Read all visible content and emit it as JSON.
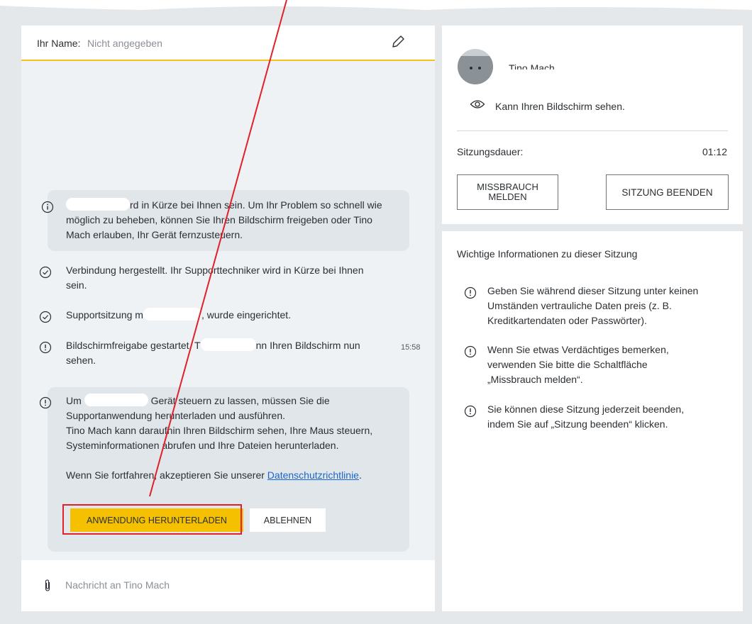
{
  "chat": {
    "name_label": "Ihr Name:",
    "name_value": "Nicht angegeben",
    "messages": [
      {
        "lines": [
          "rd in Kürze bei Ihnen sein. Um Ihr Problem so schnell wie",
          "möglich zu beheben, können Sie Ihren Bildschirm freigeben oder Tino",
          "Mach erlauben, Ihr Gerät fernzusteuern."
        ]
      },
      {
        "lines": [
          "Verbindung hergestellt. Ihr Supporttechniker wird in Kürze bei Ihnen",
          "sein."
        ]
      },
      {
        "part1": "Supportsitzung m",
        "part2": ", wurde eingerichtet."
      },
      {
        "part1": "Bildschirmfreigabe gestartet. T",
        "part2": "nn Ihren Bildschirm nun",
        "line2": "sehen.",
        "time": "15:58"
      },
      {
        "part1": "Um",
        "part2": "Gerät steuern zu lassen, müssen Sie die",
        "lines": [
          "Supportanwendung herunterladen und ausführen.",
          "Tino Mach kann daraufhin Ihren Bildschirm sehen, Ihre Maus steuern,",
          "Systeminformationen abrufen und Ihre Dateien herunterladen."
        ],
        "consent_text": "Wenn Sie fortfahren, akzeptieren Sie unserer",
        "privacy_link": "Datenschutzrichtlinie",
        "period": ".",
        "download_button": "ANWENDUNG HERUNTERLADEN",
        "decline_button": "ABLEHNEN"
      }
    ],
    "input_placeholder": "Nachricht an Tino Mach"
  },
  "session": {
    "technician_name": "Tino Mach",
    "view_status": "Kann Ihren Bildschirm sehen.",
    "duration_label": "Sitzungsdauer:",
    "duration_value": "01:12",
    "report_button_line1": "MISSBRAUCH",
    "report_button_line2": "MELDEN",
    "end_button": "SITZUNG BEENDEN"
  },
  "info": {
    "title": "Wichtige Informationen zu dieser Sitzung",
    "items": [
      {
        "lines": [
          "Geben Sie während dieser Sitzung unter keinen",
          "Umständen vertrauliche Daten preis (z. B.",
          "Kreditkartendaten oder Passwörter)."
        ]
      },
      {
        "lines": [
          "Wenn Sie etwas Verdächtiges bemerken,",
          "verwenden Sie bitte die Schaltfläche",
          "„Missbrauch melden“."
        ]
      },
      {
        "lines": [
          "Sie können diese Sitzung jederzeit beenden,",
          "indem Sie auf „Sitzung beenden“ klicken."
        ]
      }
    ]
  },
  "colors": {
    "accent": "#f5c000",
    "highlight": "#e0202a",
    "link": "#1a66c9",
    "panel_bg": "#eef2f5"
  },
  "icons": [
    "pencil-icon",
    "info-icon",
    "check-circle-icon",
    "alert-circle-icon",
    "paperclip-icon",
    "eye-icon",
    "avatar"
  ]
}
